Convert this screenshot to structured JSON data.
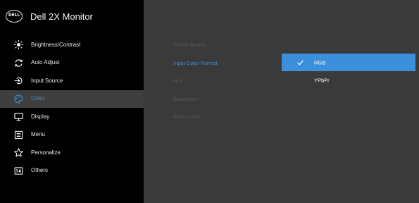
{
  "brand": {
    "logo_text": "DELL",
    "product_name": "Dell 2X Monitor"
  },
  "menu": {
    "items": [
      {
        "label": "Brightness/Contrast",
        "icon": "brightness-icon"
      },
      {
        "label": "Auto Adjust",
        "icon": "auto-adjust-icon"
      },
      {
        "label": "Input Source",
        "icon": "input-source-icon"
      },
      {
        "label": "Color",
        "icon": "color-palette-icon",
        "active": true
      },
      {
        "label": "Display",
        "icon": "display-icon"
      },
      {
        "label": "Menu",
        "icon": "menu-icon"
      },
      {
        "label": "Personalize",
        "icon": "star-icon"
      },
      {
        "label": "Others",
        "icon": "others-icon"
      }
    ]
  },
  "submenu": {
    "items": [
      {
        "label": "Preset Modes"
      },
      {
        "label": "Input Color Format",
        "active": true
      },
      {
        "label": "Hue"
      },
      {
        "label": "Saturation"
      },
      {
        "label": "Reset Color"
      }
    ]
  },
  "options": {
    "items": [
      {
        "label": "RGB",
        "selected": true
      },
      {
        "label": "YPbPr"
      }
    ]
  },
  "colors": {
    "background": "#3a3a3a",
    "sidebar": "#000000",
    "accent": "#3b8fdb",
    "active_row": "#3f3f3f",
    "disabled_text": "#5a5a5a"
  }
}
